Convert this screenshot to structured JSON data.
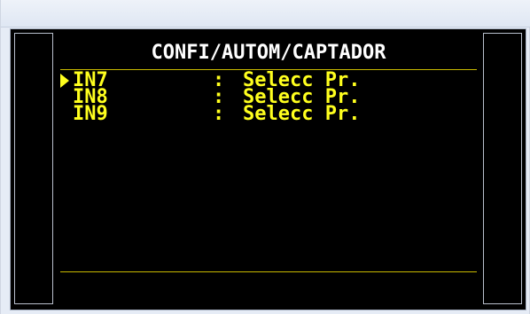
{
  "screen": {
    "title": "CONFI/AUTOM/CAPTADOR"
  },
  "rows": [
    {
      "label": "IN7",
      "separator": ":",
      "value": "Selecc Pr.",
      "selected": true
    },
    {
      "label": "IN8",
      "separator": ":",
      "value": "Selecc Pr.",
      "selected": false
    },
    {
      "label": "IN9",
      "separator": ":",
      "value": "Selecc Pr.",
      "selected": false
    }
  ],
  "colors": {
    "text_highlight": "#ffff1e",
    "rule": "#c8b800",
    "background": "#000000",
    "title": "#ffffff"
  },
  "icons": {
    "cursor": "selection-arrow-icon"
  }
}
